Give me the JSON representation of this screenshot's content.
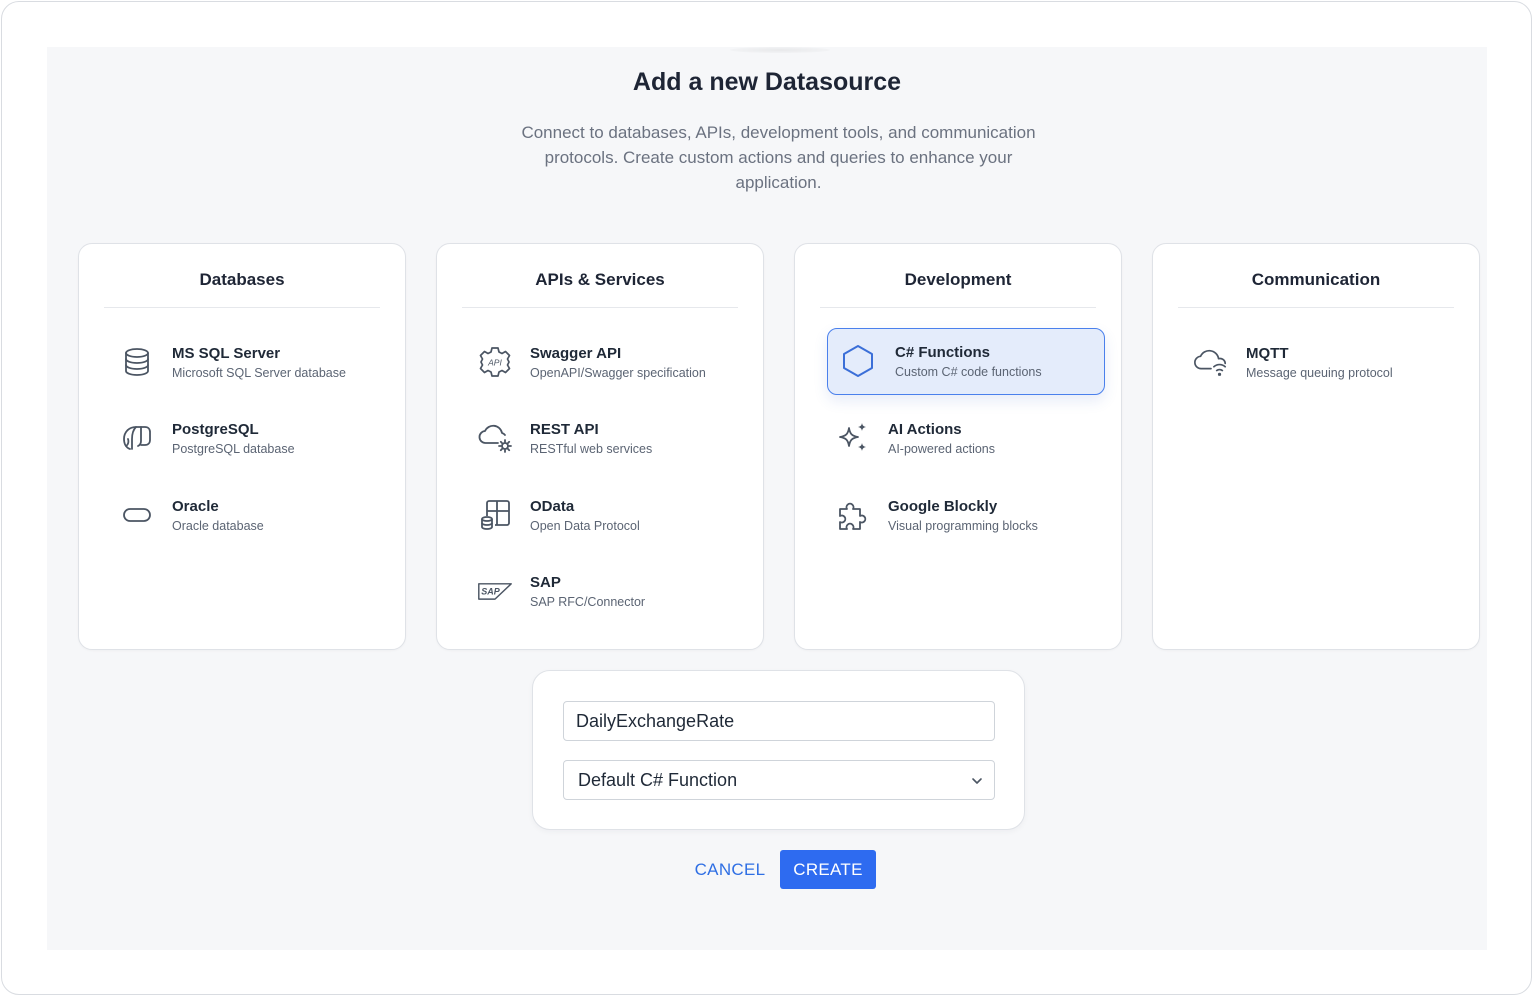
{
  "dialog": {
    "title": "Add a new Datasource",
    "subtitle": "Connect to databases, APIs, development tools, and communication protocols. Create custom actions and queries to enhance your application."
  },
  "categories": [
    {
      "title": "Databases",
      "items": [
        {
          "name": "MS SQL Server",
          "desc": "Microsoft SQL Server database",
          "icon": "database-icon"
        },
        {
          "name": "PostgreSQL",
          "desc": "PostgreSQL database",
          "icon": "postgresql-elephant-icon"
        },
        {
          "name": "Oracle",
          "desc": "Oracle database",
          "icon": "oracle-icon"
        }
      ]
    },
    {
      "title": "APIs & Services",
      "items": [
        {
          "name": "Swagger API",
          "desc": "OpenAPI/Swagger specification",
          "icon": "api-gear-icon"
        },
        {
          "name": "REST API",
          "desc": "RESTful web services",
          "icon": "cloud-gear-icon"
        },
        {
          "name": "OData",
          "desc": "Open Data Protocol",
          "icon": "odata-table-icon"
        },
        {
          "name": "SAP",
          "desc": "SAP RFC/Connector",
          "icon": "sap-logo-icon"
        }
      ]
    },
    {
      "title": "Development",
      "items": [
        {
          "name": "C# Functions",
          "desc": "Custom C# code functions",
          "icon": "hexagon-icon",
          "selected": true
        },
        {
          "name": "AI Actions",
          "desc": "AI-powered actions",
          "icon": "sparkles-icon"
        },
        {
          "name": "Google Blockly",
          "desc": "Visual programming blocks",
          "icon": "puzzle-icon"
        }
      ]
    },
    {
      "title": "Communication",
      "items": [
        {
          "name": "MQTT",
          "desc": "Message queuing protocol",
          "icon": "cloud-wifi-icon"
        }
      ]
    }
  ],
  "form": {
    "name_value": "DailyExchangeRate",
    "template_value": "Default C# Function"
  },
  "actions": {
    "cancel_label": "CANCEL",
    "create_label": "CREATE"
  },
  "colors": {
    "accent": "#2e6bf0",
    "selected_bg": "#e4ecfb",
    "icon": "#4b5563",
    "panel_bg": "#f6f7f9"
  }
}
